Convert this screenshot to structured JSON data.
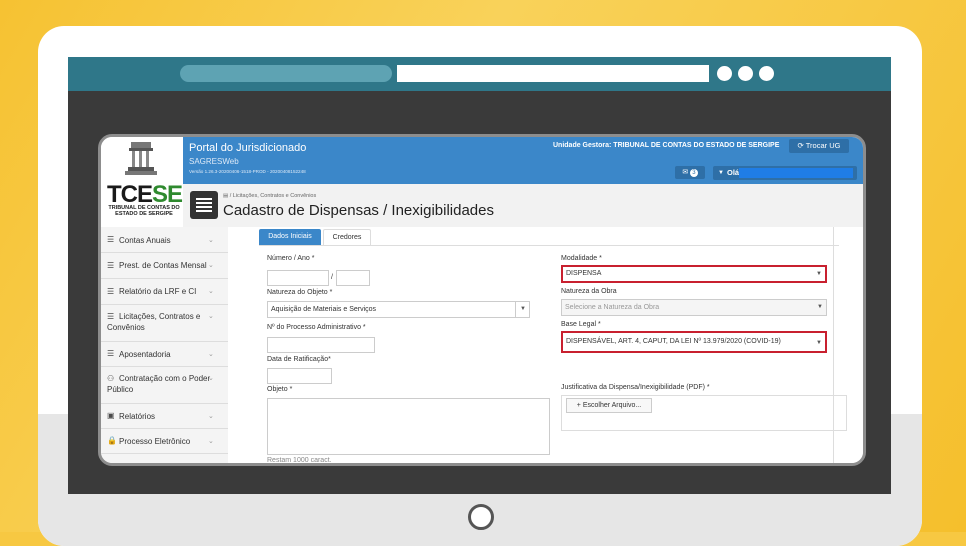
{
  "header": {
    "portal_title": "Portal do Jurisdicionado",
    "app_name": "SAGRESWeb",
    "version": "Versão 1.26.3-20200406-1518-PROD - 20200408152248",
    "ug_label": "Unidade Gestora: TRIBUNAL DE CONTAS DO ESTADO DE SERGIPE",
    "trocar_label": "Trocar UG",
    "msg_count": "3",
    "greeting": "Olá"
  },
  "logo": {
    "tce_a": "TCE",
    "tce_b": "SE",
    "sub": "TRIBUNAL DE CONTAS DO ESTADO DE SERGIPE"
  },
  "page": {
    "breadcrumb": "Licitações, Contratos e Convênios",
    "title": "Cadastro de Dispensas / Inexigibilidades"
  },
  "sidebar": {
    "items": [
      {
        "label": "Contas Anuais",
        "icon": "database-icon"
      },
      {
        "label": "Prest. de Contas Mensal",
        "icon": "database-icon"
      },
      {
        "label": "Relatório da LRF e CI",
        "icon": "database-icon"
      },
      {
        "label": "Licitações, Contratos e",
        "label2": "Convênios",
        "icon": "list-icon"
      },
      {
        "label": "Aposentadoria",
        "icon": "list-icon"
      },
      {
        "label": "Contratação com o Poder",
        "label2": "Público",
        "icon": "handshake-icon"
      },
      {
        "label": "Relatórios",
        "icon": "chart-icon"
      },
      {
        "label": "Processo Eletrônico",
        "icon": "lock-icon"
      }
    ]
  },
  "tabs": [
    "Dados Iniciais",
    "Credores"
  ],
  "form": {
    "numero_label": "Número / Ano *",
    "slash": "/",
    "natureza_label": "Natureza do Objeto *",
    "natureza_value": "Aquisição de Materiais e Serviços",
    "processo_label": "Nº do Processo Administrativo *",
    "ratificacao_label": "Data de Ratificação*",
    "objeto_label": "Objeto *",
    "restam_label": "Restam 1000 caract.",
    "modalidade_label": "Modalidade *",
    "modalidade_value": "DISPENSA",
    "natureza_obra_label": "Natureza da Obra",
    "natureza_obra_placeholder": "Selecione a Natureza da Obra",
    "base_legal_label": "Base Legal *",
    "base_legal_value": "DISPENSÁVEL, ART. 4, CAPUT, DA LEI Nº 13.979/2020 (COVID-19)",
    "justificativa_label": "Justificativa da Dispensa/Inexigibilidade (PDF) *",
    "escolher_label": "Escolher Arquivo..."
  },
  "colors": {
    "topbar": "#3b87c9",
    "highlight": "#c8202f",
    "frame": "#2f7789",
    "background": "#f7c842"
  }
}
